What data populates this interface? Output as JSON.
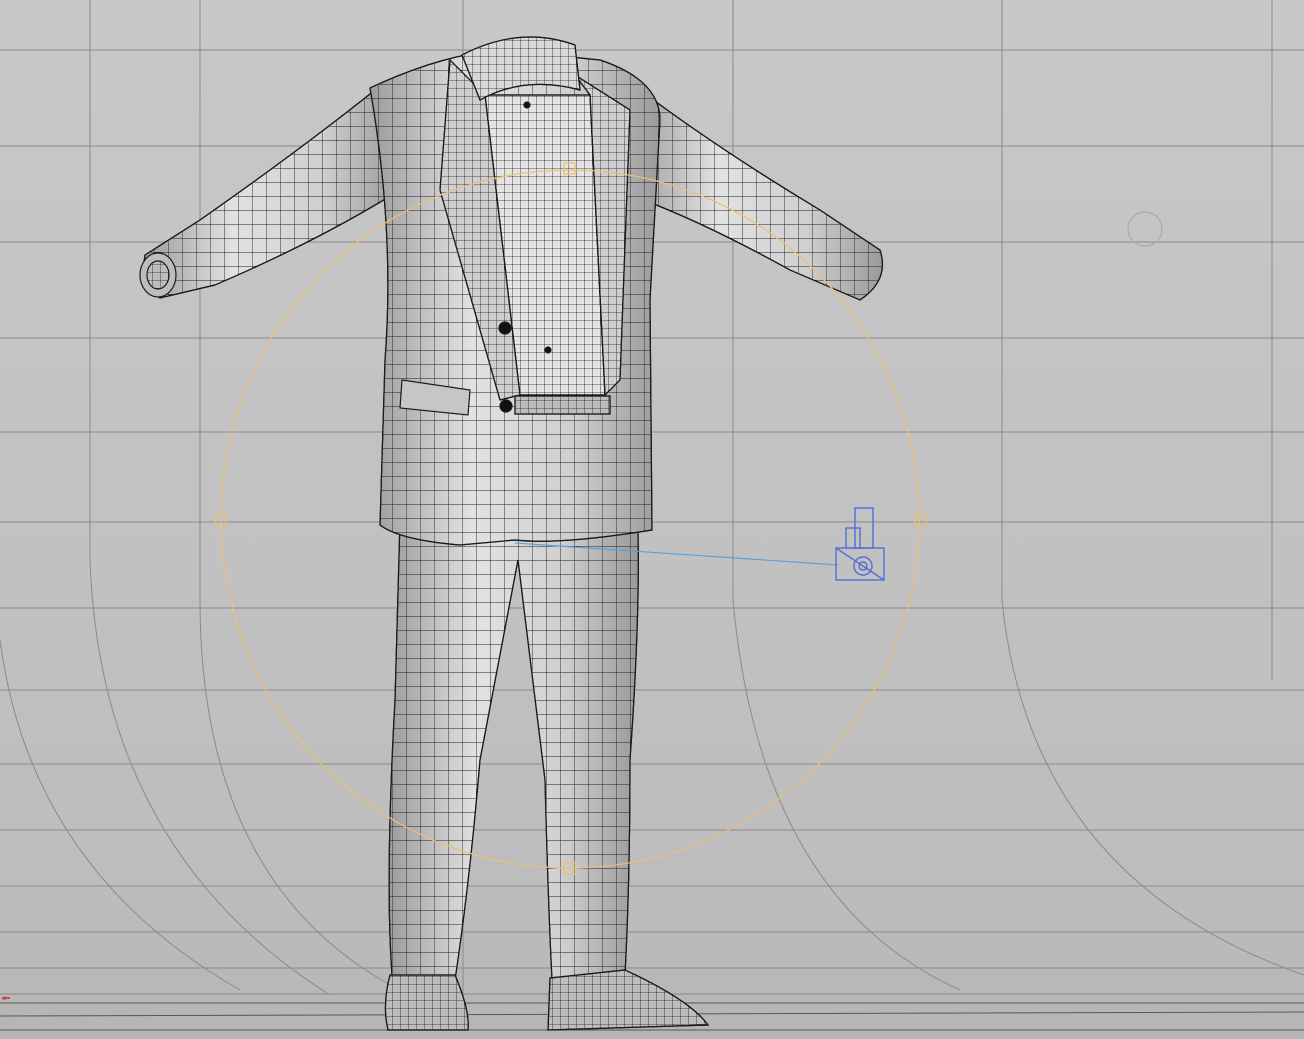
{
  "viewport": {
    "label": "",
    "colors": {
      "background": "#c4c4c4",
      "grid": "#8a8a8a",
      "mesh_fill": "#d6d6d6",
      "mesh_shade": "#a9a9a9",
      "wireframe": "#1a1a1a",
      "selection_ring": "#e8c07a",
      "camera": "#4f6fd6",
      "camera_target_line": "#5aa0e0",
      "axis_x": "#d03030"
    },
    "objects": [
      {
        "name": "suit-mesh",
        "icon": "mesh-icon",
        "kind": "wireframe-garment"
      },
      {
        "name": "scene-camera",
        "icon": "camera-icon",
        "kind": "camera"
      },
      {
        "name": "rotate-gizmo",
        "icon": "rotate-gizmo-icon",
        "kind": "manipulator"
      }
    ]
  }
}
